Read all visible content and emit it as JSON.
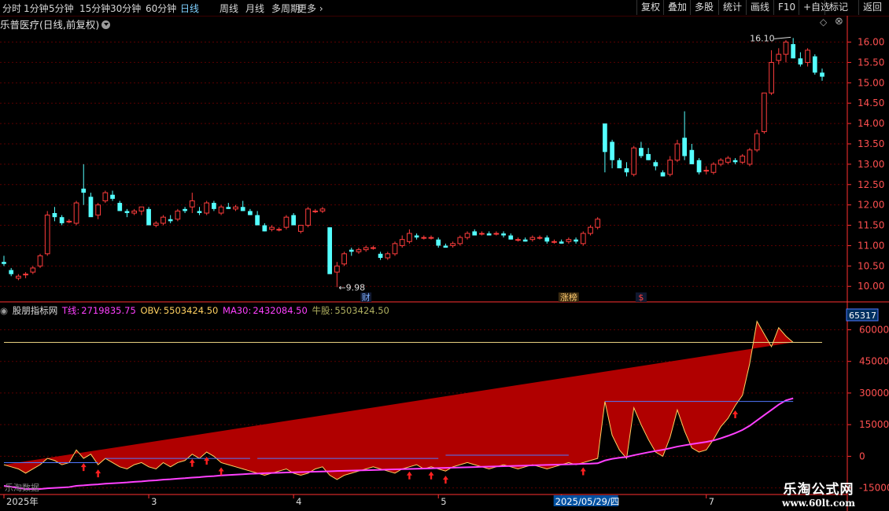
{
  "toolbar": {
    "periods": [
      "分时",
      "1分钟",
      "5分钟",
      "15分钟",
      "30分钟",
      "60分钟",
      "日线",
      "周线",
      "月线",
      "多周期",
      "更多"
    ],
    "active": "日线",
    "buttons": [
      "复权",
      "叠加",
      "多股",
      "统计",
      "画线",
      "F10",
      "+自选",
      "标记",
      "返回"
    ]
  },
  "chart_title": "乐普医疗(日线,前复权)",
  "indicator": {
    "name": "股朋指标网",
    "t_label": "T线:",
    "t_value": "2719835.75",
    "obv_label": "OBV:",
    "obv_value": "5503424.50",
    "ma_label": "MA30:",
    "ma_value": "2432084.50",
    "bull_label": "牛股:",
    "bull_value": "5503424.50",
    "box_value": "65317",
    "bottom_left_text": "乐淘数据"
  },
  "colors": {
    "up": "#ff3c3c",
    "down": "#54ffff",
    "fill": "#b00000",
    "obv_line": "#ffd060",
    "ma_line": "#ff40ff",
    "t_line": "#5078ff",
    "axis": "#ff3030",
    "hline": "#e8d080"
  },
  "chart_data": [
    {
      "type": "candlestick",
      "y_ticks": [
        "16.00",
        "15.50",
        "15.00",
        "14.50",
        "14.00",
        "13.50",
        "13.00",
        "12.50",
        "12.00",
        "11.50",
        "11.00",
        "10.50",
        "10.00"
      ],
      "ylim": [
        9.85,
        16.3
      ],
      "high_label": "16.10",
      "low_label": "9.98",
      "markers": [
        {
          "label": "财",
          "index": 50
        },
        {
          "label": "涨榜",
          "index": 78
        },
        {
          "label": "$",
          "index": 88
        }
      ],
      "x_labels": [
        {
          "label": "2025年",
          "index": 0
        },
        {
          "label": "3",
          "index": 20
        },
        {
          "label": "4",
          "index": 40
        },
        {
          "label": "5",
          "index": 60
        },
        {
          "label": "2025/05/29/四",
          "index": 77
        },
        {
          "label": "7",
          "index": 97
        }
      ],
      "ohlc": [
        [
          10.6,
          10.75,
          10.5,
          10.55
        ],
        [
          10.4,
          10.45,
          10.25,
          10.3
        ],
        [
          10.2,
          10.3,
          10.15,
          10.25
        ],
        [
          10.3,
          10.35,
          10.2,
          10.3
        ],
        [
          10.35,
          10.5,
          10.3,
          10.45
        ],
        [
          10.5,
          10.8,
          10.45,
          10.75
        ],
        [
          10.8,
          11.85,
          10.75,
          11.75
        ],
        [
          11.8,
          11.95,
          11.6,
          11.7
        ],
        [
          11.7,
          11.75,
          11.5,
          11.55
        ],
        [
          11.6,
          11.65,
          11.55,
          11.6
        ],
        [
          11.55,
          12.1,
          11.5,
          12.05
        ],
        [
          12.4,
          13.0,
          12.0,
          12.3
        ],
        [
          12.2,
          12.3,
          11.75,
          11.7
        ],
        [
          11.75,
          12.05,
          11.65,
          12.0
        ],
        [
          12.1,
          12.35,
          12.05,
          12.3
        ],
        [
          12.25,
          12.35,
          12.1,
          12.15
        ],
        [
          12.05,
          12.1,
          11.85,
          11.85
        ],
        [
          11.85,
          11.9,
          11.7,
          11.8
        ],
        [
          11.8,
          11.9,
          11.75,
          11.85
        ],
        [
          11.85,
          11.95,
          11.75,
          11.95
        ],
        [
          11.9,
          11.95,
          11.5,
          11.5
        ],
        [
          11.5,
          11.6,
          11.45,
          11.55
        ],
        [
          11.55,
          11.75,
          11.5,
          11.7
        ],
        [
          11.65,
          11.75,
          11.55,
          11.6
        ],
        [
          11.65,
          11.9,
          11.6,
          11.85
        ],
        [
          11.9,
          11.95,
          11.8,
          11.85
        ],
        [
          11.95,
          12.3,
          11.8,
          12.1
        ],
        [
          11.85,
          11.95,
          11.75,
          11.8
        ],
        [
          11.8,
          12.1,
          11.75,
          12.05
        ],
        [
          12.05,
          12.1,
          11.85,
          11.9
        ],
        [
          11.8,
          12.0,
          11.75,
          11.95
        ],
        [
          11.95,
          12.05,
          11.9,
          11.9
        ],
        [
          11.9,
          12.0,
          11.85,
          11.95
        ],
        [
          11.95,
          12.1,
          11.85,
          11.85
        ],
        [
          11.85,
          11.9,
          11.75,
          11.75
        ],
        [
          11.75,
          11.85,
          11.5,
          11.5
        ],
        [
          11.5,
          11.55,
          11.35,
          11.35
        ],
        [
          11.4,
          11.5,
          11.35,
          11.45
        ],
        [
          11.4,
          11.45,
          11.35,
          11.4
        ],
        [
          11.45,
          11.75,
          11.4,
          11.7
        ],
        [
          11.75,
          11.8,
          11.5,
          11.5
        ],
        [
          11.35,
          11.5,
          11.3,
          11.5
        ],
        [
          11.5,
          11.95,
          11.45,
          11.9
        ],
        [
          11.85,
          11.9,
          11.8,
          11.85
        ],
        [
          11.85,
          11.95,
          11.8,
          11.9
        ],
        [
          11.45,
          11.45,
          10.5,
          10.3
        ],
        [
          10.35,
          10.6,
          9.98,
          10.5
        ],
        [
          10.55,
          10.85,
          10.5,
          10.8
        ],
        [
          10.9,
          10.95,
          10.75,
          10.85
        ],
        [
          10.85,
          10.95,
          10.8,
          10.9
        ],
        [
          10.9,
          11.0,
          10.85,
          10.95
        ],
        [
          10.95,
          11.0,
          10.9,
          10.95
        ],
        [
          10.8,
          10.85,
          10.65,
          10.7
        ],
        [
          10.7,
          10.85,
          10.65,
          10.8
        ],
        [
          10.8,
          11.1,
          10.75,
          11.05
        ],
        [
          11.0,
          11.25,
          10.95,
          11.15
        ],
        [
          11.1,
          11.4,
          11.05,
          11.3
        ],
        [
          11.25,
          11.3,
          11.15,
          11.2
        ],
        [
          11.2,
          11.25,
          11.15,
          11.2
        ],
        [
          11.2,
          11.25,
          11.15,
          11.2
        ],
        [
          11.15,
          11.2,
          10.95,
          11.0
        ],
        [
          11.0,
          11.05,
          10.95,
          10.95
        ],
        [
          11.0,
          11.1,
          10.95,
          11.05
        ],
        [
          11.05,
          11.25,
          11.0,
          11.2
        ],
        [
          11.2,
          11.35,
          11.15,
          11.3
        ],
        [
          11.35,
          11.4,
          11.25,
          11.25
        ],
        [
          11.3,
          11.35,
          11.25,
          11.3
        ],
        [
          11.3,
          11.35,
          11.25,
          11.25
        ],
        [
          11.3,
          11.35,
          11.25,
          11.3
        ],
        [
          11.3,
          11.35,
          11.2,
          11.25
        ],
        [
          11.25,
          11.3,
          11.15,
          11.15
        ],
        [
          11.15,
          11.2,
          11.1,
          11.15
        ],
        [
          11.15,
          11.2,
          11.1,
          11.1
        ],
        [
          11.15,
          11.25,
          11.1,
          11.2
        ],
        [
          11.2,
          11.25,
          11.15,
          11.2
        ],
        [
          11.2,
          11.25,
          11.05,
          11.1
        ],
        [
          11.1,
          11.15,
          11.05,
          11.1
        ],
        [
          11.1,
          11.15,
          11.05,
          11.05
        ],
        [
          11.1,
          11.2,
          11.05,
          11.15
        ],
        [
          11.15,
          11.2,
          11.05,
          11.1
        ],
        [
          11.05,
          11.35,
          11.0,
          11.3
        ],
        [
          11.3,
          11.5,
          11.25,
          11.45
        ],
        [
          11.45,
          11.7,
          11.4,
          11.65
        ],
        [
          14.0,
          14.0,
          12.8,
          13.3
        ],
        [
          13.55,
          13.6,
          12.9,
          13.1
        ],
        [
          13.1,
          13.15,
          12.9,
          12.9
        ],
        [
          12.9,
          13.05,
          12.7,
          12.8
        ],
        [
          12.75,
          13.45,
          12.7,
          13.4
        ],
        [
          13.4,
          13.55,
          13.15,
          13.2
        ],
        [
          13.25,
          13.4,
          13.1,
          13.1
        ],
        [
          13.05,
          13.1,
          12.85,
          12.95
        ],
        [
          12.8,
          12.85,
          12.7,
          12.7
        ],
        [
          12.75,
          13.2,
          12.7,
          13.1
        ],
        [
          13.1,
          13.6,
          13.05,
          13.5
        ],
        [
          13.65,
          14.3,
          13.1,
          13.2
        ],
        [
          13.35,
          13.5,
          13.0,
          13.0
        ],
        [
          13.1,
          13.15,
          12.75,
          12.8
        ],
        [
          12.85,
          12.95,
          12.75,
          12.85
        ],
        [
          12.8,
          13.05,
          12.75,
          13.0
        ],
        [
          13.0,
          13.15,
          12.95,
          13.1
        ],
        [
          13.05,
          13.2,
          13.0,
          13.15
        ],
        [
          13.1,
          13.15,
          13.0,
          13.05
        ],
        [
          13.05,
          13.25,
          13.0,
          13.2
        ],
        [
          13.0,
          13.4,
          12.95,
          13.35
        ],
        [
          13.35,
          13.85,
          13.3,
          13.75
        ],
        [
          13.8,
          14.5,
          13.75,
          14.75
        ],
        [
          14.75,
          15.8,
          14.7,
          15.5
        ],
        [
          15.55,
          15.85,
          15.45,
          15.7
        ],
        [
          15.7,
          16.05,
          15.5,
          16.0
        ],
        [
          15.95,
          16.1,
          15.6,
          15.6
        ],
        [
          15.6,
          15.75,
          15.4,
          15.45
        ],
        [
          15.5,
          15.85,
          15.4,
          15.8
        ],
        [
          15.65,
          15.7,
          15.2,
          15.25
        ],
        [
          15.25,
          15.35,
          15.05,
          15.15
        ]
      ]
    },
    {
      "type": "area",
      "y_ticks": [
        "60000",
        "45000",
        "30000",
        "15000",
        "0",
        "-15000"
      ],
      "ylim": [
        -17000,
        68000
      ],
      "hline": 54000,
      "arrow_indices": [
        11,
        13,
        26,
        28,
        30,
        56,
        59,
        61,
        80,
        101
      ],
      "obv": [
        -4000,
        -5000,
        -6000,
        -8000,
        -6000,
        -4000,
        -1000,
        -2000,
        -4000,
        -3000,
        3000,
        -1000,
        1000,
        -4000,
        -1000,
        -3000,
        -5000,
        -6000,
        -4000,
        -3000,
        -5000,
        -6000,
        -3000,
        -5000,
        -3000,
        -2000,
        1000,
        -1000,
        2000,
        0,
        -3000,
        -4000,
        -5000,
        -6000,
        -7000,
        -8000,
        -9000,
        -8000,
        -7000,
        -6000,
        -8000,
        -9000,
        -8000,
        -6000,
        -5000,
        -9000,
        -11000,
        -9000,
        -8000,
        -7000,
        -6000,
        -5000,
        -6000,
        -7000,
        -8000,
        -6000,
        -5000,
        -4000,
        -6000,
        -5000,
        -6000,
        -7000,
        -5000,
        -4000,
        -3000,
        -4000,
        -5000,
        -6000,
        -5000,
        -4000,
        -5000,
        -6000,
        -5000,
        -4000,
        -5000,
        -6000,
        -5000,
        -4000,
        -3000,
        -4000,
        -3000,
        -2000,
        -1000,
        26000,
        10000,
        3000,
        -1000,
        23000,
        15000,
        8000,
        2000,
        0,
        9000,
        22000,
        12000,
        4000,
        2000,
        3000,
        8000,
        14000,
        18000,
        24000,
        29000,
        44000,
        64000,
        58000,
        52000,
        61000,
        57000,
        54000
      ],
      "ma": [
        -14000,
        -14500,
        -15000,
        -15500,
        -15500,
        -15500,
        -15200,
        -15000,
        -14800,
        -14600,
        -14000,
        -13800,
        -13500,
        -13300,
        -13000,
        -12800,
        -12600,
        -12400,
        -12100,
        -11900,
        -11600,
        -11400,
        -11100,
        -10900,
        -10600,
        -10400,
        -10100,
        -9900,
        -9600,
        -9400,
        -9100,
        -8900,
        -8700,
        -8500,
        -8300,
        -8200,
        -8000,
        -7900,
        -7800,
        -7700,
        -7600,
        -7500,
        -7400,
        -7300,
        -7200,
        -7100,
        -7000,
        -6900,
        -6800,
        -6700,
        -6600,
        -6500,
        -6400,
        -6300,
        -6200,
        -6100,
        -6000,
        -5900,
        -5800,
        -5700,
        -5600,
        -5500,
        -5400,
        -5300,
        -5200,
        -5100,
        -5000,
        -4900,
        -4800,
        -4700,
        -4600,
        -4500,
        -4400,
        -4300,
        -4200,
        -4100,
        -4000,
        -3900,
        -3800,
        -3700,
        -3600,
        -3500,
        -3300,
        -2000,
        -1200,
        -700,
        -300,
        500,
        1200,
        1900,
        2500,
        3100,
        3800,
        4600,
        5200,
        5800,
        6300,
        6800,
        7500,
        8500,
        9700,
        11000,
        12500,
        14500,
        17000,
        19500,
        22000,
        24500,
        26500,
        27500
      ]
    }
  ]
}
